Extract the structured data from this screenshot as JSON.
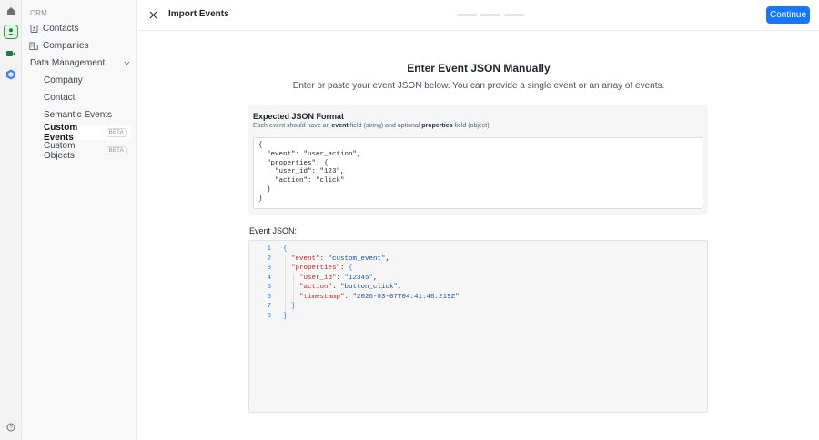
{
  "sidebar": {
    "section_label": "CRM",
    "items": [
      {
        "label": "Contacts",
        "icon": "contact-card-icon"
      },
      {
        "label": "Companies",
        "icon": "building-icon"
      }
    ],
    "group": {
      "label": "Data Management",
      "icon": "chevron-down-icon"
    },
    "sub_items": [
      {
        "label": "Company"
      },
      {
        "label": "Contact"
      },
      {
        "label": "Semantic Events"
      },
      {
        "label": "Custom Events",
        "badge": "BETA",
        "active": true
      },
      {
        "label": "Custom Objects",
        "badge": "BETA"
      }
    ]
  },
  "header": {
    "title": "Import Events",
    "continue_label": "Continue",
    "steps": 3
  },
  "main": {
    "title": "Enter Event JSON Manually",
    "subtitle": "Enter or paste your event JSON below. You can provide a single event or an array of events.",
    "format": {
      "title": "Expected JSON Format",
      "desc_1": "Each event should have an",
      "desc_event": "event",
      "desc_2": "field (string) and optional",
      "desc_properties": "properties",
      "desc_3": "field (object).",
      "example": "{\n  \"event\": \"user_action\",\n  \"properties\": {\n    \"user_id\": \"123\",\n    \"action\": \"click\"\n  }\n}"
    },
    "editor_label": "Event JSON:",
    "editor_lines": [
      "1",
      "2",
      "3",
      "4",
      "5",
      "6",
      "7",
      "8"
    ],
    "editor_code": {
      "open": "{",
      "k_event": "\"event\"",
      "v_event": "\"custom_event\"",
      "k_properties": "\"properties\"",
      "p_open": "{",
      "k_user_id": "\"user_id\"",
      "v_user_id": "\"12345\"",
      "k_action": "\"action\"",
      "v_action": "\"button_click\"",
      "k_timestamp": "\"timestamp\"",
      "v_timestamp": "\"2026-03-07T04:41:46.219Z\"",
      "p_close": "}",
      "close": "}"
    }
  },
  "colors": {
    "accent": "#1677ff",
    "active_app": "#2f9e4a",
    "json_key": "#c1272d",
    "json_string": "#1a4f9e"
  }
}
